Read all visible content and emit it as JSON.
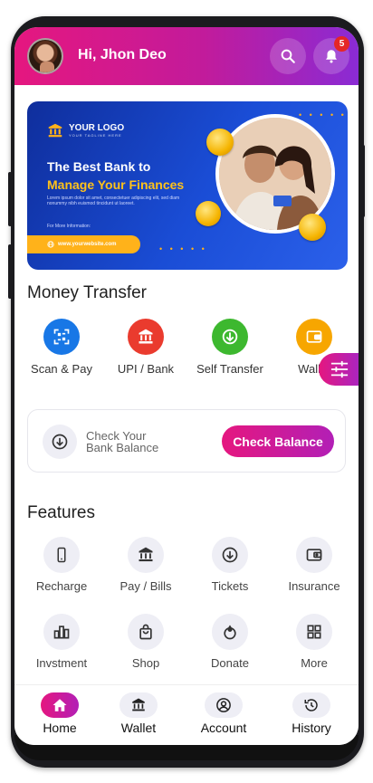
{
  "header": {
    "greeting": "Hi, Jhon Deo",
    "notification_count": "5",
    "gradient_colors": [
      "#e5177f",
      "#8a2bd4"
    ]
  },
  "banner": {
    "logo_text": "YOUR LOGO",
    "logo_tagline": "YOUR TAGLINE HERE",
    "headline_1": "The Best Bank to",
    "headline_2": "Manage Your Finances",
    "description": "Lorem ipsum dolor sit amet, consectetuer adipiscing elit, sed diam nonummy nibh euismod tincidunt ut laoreet.",
    "more_info": "For More Information:",
    "website": "www.yourwebsite.com",
    "accent_color": "#ffb21a"
  },
  "money_transfer": {
    "title": "Money Transfer",
    "items": [
      {
        "label": "Scan & Pay",
        "icon": "qr-scan-icon",
        "color": "#1877e6"
      },
      {
        "label": "UPI / Bank",
        "icon": "bank-icon",
        "color": "#ea3b2e"
      },
      {
        "label": "Self Transfer",
        "icon": "download-circle-icon",
        "color": "#3db82f"
      },
      {
        "label": "Wallet",
        "icon": "wallet-icon",
        "color": "#f7a600"
      }
    ]
  },
  "balance_card": {
    "text_line_1": "Check Your",
    "text_line_2": "Bank Balance",
    "button_label": "Check Balance"
  },
  "features": {
    "title": "Features",
    "items": [
      {
        "label": "Recharge",
        "icon": "phone-icon"
      },
      {
        "label": "Pay / Bills",
        "icon": "bank-icon"
      },
      {
        "label": "Tickets",
        "icon": "download-circle-icon"
      },
      {
        "label": "Insurance",
        "icon": "wallet-icon"
      },
      {
        "label": "Invstment",
        "icon": "bar-chart-icon"
      },
      {
        "label": "Shop",
        "icon": "shopping-bag-icon"
      },
      {
        "label": "Donate",
        "icon": "donate-icon"
      },
      {
        "label": "More",
        "icon": "grid-icon"
      }
    ]
  },
  "bottom_nav": {
    "items": [
      {
        "label": "Home",
        "icon": "home-icon",
        "active": true
      },
      {
        "label": "Wallet",
        "icon": "bank-icon",
        "active": false
      },
      {
        "label": "Account",
        "icon": "account-icon",
        "active": false
      },
      {
        "label": "History",
        "icon": "history-icon",
        "active": false
      }
    ]
  }
}
